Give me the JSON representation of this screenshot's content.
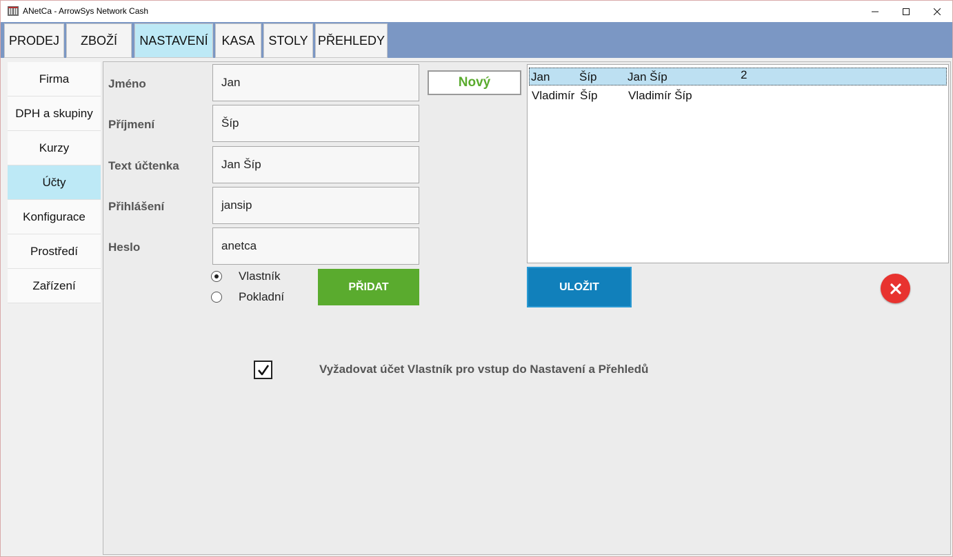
{
  "window": {
    "title": "ANetCa - ArrowSys Network Cash",
    "controls": {
      "minimize": "—",
      "maximize": "☐",
      "close": "✕"
    }
  },
  "tabs": [
    "PRODEJ",
    "ZBOŽÍ",
    "NASTAVENÍ",
    "KASA",
    "STOLY",
    "PŘEHLEDY"
  ],
  "active_tab": "NASTAVENÍ",
  "sidebar": {
    "items": [
      "Firma",
      "DPH a skupiny",
      "Kurzy",
      "Účty",
      "Konfigurace",
      "Prostředí",
      "Zařízení"
    ],
    "active": "Účty"
  },
  "form": {
    "fields": [
      {
        "label": "Jméno",
        "value": "Jan"
      },
      {
        "label": "Příjmení",
        "value": "Šíp"
      },
      {
        "label": "Text účtenka",
        "value": "Jan Šíp"
      },
      {
        "label": "Přihlášení",
        "value": "jansip"
      },
      {
        "label": "Heslo",
        "value": "anetca"
      }
    ],
    "novy_label": "Nový",
    "roles": [
      {
        "label": "Vlastník",
        "checked": true
      },
      {
        "label": "Pokladní",
        "checked": false
      }
    ],
    "pridat_label": "PŘIDAT"
  },
  "accounts_list": {
    "rows": [
      {
        "first": "Jan",
        "last": "Šíp",
        "display": "Jan Šíp",
        "extra": "2",
        "selected": true
      },
      {
        "first": "Vladimír",
        "last": "Šíp",
        "display": "Vladimír Šíp",
        "extra": "",
        "selected": false
      }
    ]
  },
  "ulozit_label": "ULOŽIT",
  "delete_icon": "close-icon",
  "require_owner": {
    "checked": true,
    "label": "Vyžadovat účet Vlastník pro vstup do Nastavení a Přehledů"
  },
  "colors": {
    "tabbar": "#7b97c4",
    "active_tab": "#bde9f6",
    "green": "#5aab2e",
    "blue": "#1180bb",
    "red": "#e8332f"
  }
}
